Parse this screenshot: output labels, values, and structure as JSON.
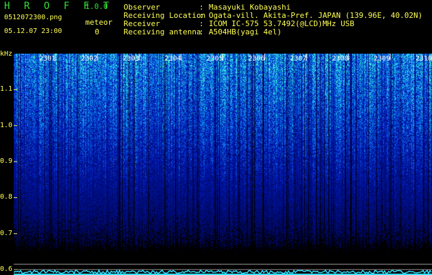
{
  "header": {
    "app_title": "H R O F F T",
    "app_version": "1.0.0",
    "file_name": "0512072300.png",
    "date_time": "05.12.07 23:00",
    "meteor_label": "meteor",
    "meteor_count": "0",
    "info": [
      {
        "label": "Observer",
        "value": "Masayuki Kobayashi"
      },
      {
        "label": "Receiving Location",
        "value": "Ogata-vill. Akita-Pref. JAPAN (139.96E, 40.02N)"
      },
      {
        "label": "Receiver",
        "value": "ICOM IC-575 53.7492(@LCD)MHz USB"
      },
      {
        "label": "Receiving antenna",
        "value": "A504HB(yagi 4el)"
      }
    ]
  },
  "colors": {
    "title_green": "#33e033",
    "yellow_text": "#ffff55",
    "white_text": "#ffffff",
    "noise_dark": "#0000aa",
    "noise_mid": "#1f60ff",
    "noise_bright": "#40e0c0",
    "baseline_cyan": "#30e0ff",
    "divider_gray": "#9a9a9a"
  },
  "chart_data": {
    "type": "heatmap",
    "ylabel": "kHz",
    "yticks": [
      "1.1",
      "1.0",
      "0.9",
      "0.8",
      "0.7",
      "0.6"
    ],
    "ytick_values": [
      1.1,
      1.0,
      0.9,
      0.8,
      0.7,
      0.6
    ],
    "ylim": [
      0.585,
      1.2
    ],
    "xticks": [
      "2301",
      "2302",
      "2303",
      "2304",
      "2305",
      "2306",
      "2307",
      "2308",
      "2309",
      "2310"
    ],
    "xlim_minutes": [
      2300,
      2310
    ]
  }
}
